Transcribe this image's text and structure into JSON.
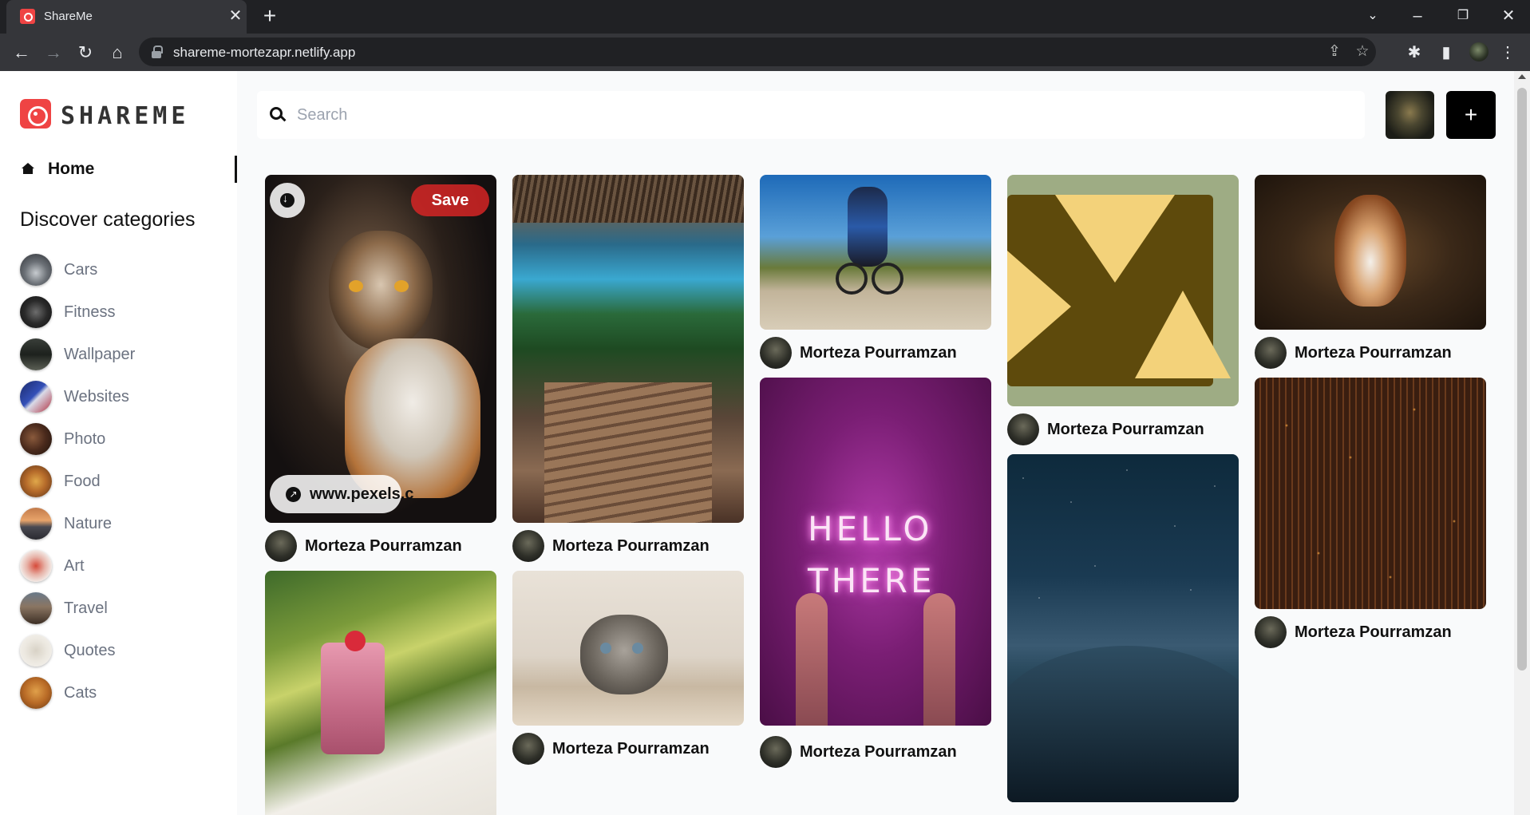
{
  "browser": {
    "tab_title": "ShareMe",
    "url": "shareme-mortezapr.netlify.app"
  },
  "app": {
    "logo_text": "SHAREME",
    "nav_home": "Home",
    "discover_heading": "Discover categories",
    "categories": [
      {
        "label": "Cars"
      },
      {
        "label": "Fitness"
      },
      {
        "label": "Wallpaper"
      },
      {
        "label": "Websites"
      },
      {
        "label": "Photo"
      },
      {
        "label": "Food"
      },
      {
        "label": "Nature"
      },
      {
        "label": "Art"
      },
      {
        "label": "Travel"
      },
      {
        "label": "Quotes"
      },
      {
        "label": "Cats"
      }
    ],
    "search_placeholder": "Search",
    "add_button": "+"
  },
  "pins": [
    {
      "author": "Morteza Pourramzan",
      "save_label": "Save",
      "link_label": "www.pexels.c"
    },
    {
      "author": "Morteza Pourramzan"
    },
    {
      "author": "Morteza Pourramzan"
    },
    {
      "author": "Morteza Pourramzan"
    },
    {
      "author": "Morteza Pourramzan"
    },
    {
      "author": "Morteza Pourramzan"
    },
    {
      "author": "Morteza Pourramzan"
    },
    {
      "author": "Morteza Pourramzan"
    },
    {
      "author": "Morteza Pourramzan"
    }
  ],
  "neon_sign_text": [
    "HELLO",
    "THERE"
  ],
  "colors": {
    "accent": "#ef4444",
    "save_button": "#dc2626"
  }
}
